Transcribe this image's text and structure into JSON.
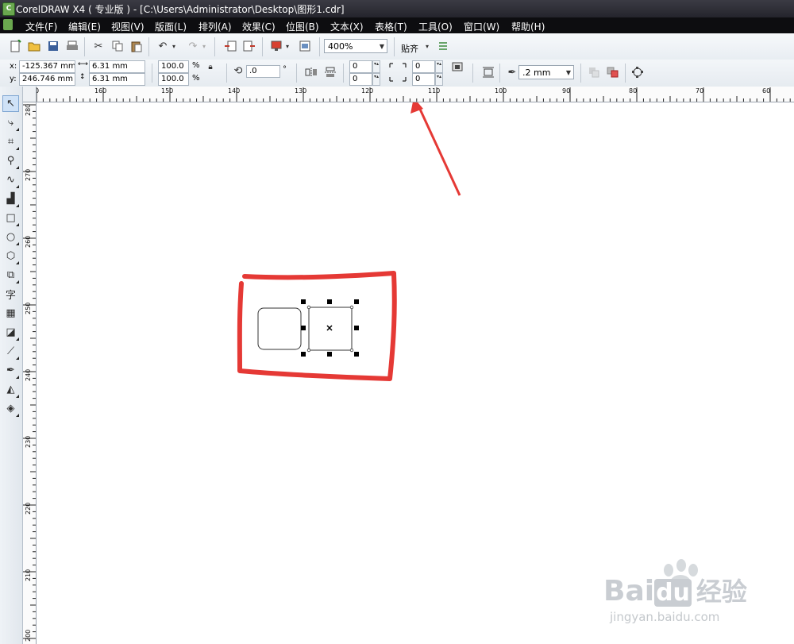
{
  "window": {
    "title": "CorelDRAW X4 ( 专业版 ) - [C:\\Users\\Administrator\\Desktop\\图形1.cdr]"
  },
  "menu": [
    "文件(F)",
    "编辑(E)",
    "视图(V)",
    "版面(L)",
    "排列(A)",
    "效果(C)",
    "位图(B)",
    "文本(X)",
    "表格(T)",
    "工具(O)",
    "窗口(W)",
    "帮助(H)"
  ],
  "standard_toolbar": {
    "zoom": "400%",
    "snap_label": "贴齐"
  },
  "property_bar": {
    "x_label": "x:",
    "x_value": "-125.367 mm",
    "y_label": "y:",
    "y_value": "246.746 mm",
    "width_value": "6.31 mm",
    "height_value": "6.31 mm",
    "scale_x": "100.0",
    "scale_y": "100.0",
    "percent": "%",
    "rotation": ".0",
    "degree": "°",
    "corner_tl": "0",
    "corner_bl": "0",
    "corner_tr": "0",
    "corner_br": "0",
    "outline_width": ".2 mm"
  },
  "ruler": {
    "top_ticks": [
      "0",
      "160",
      "150",
      "140",
      "130",
      "120",
      "110",
      "100",
      "90",
      "80",
      "70",
      "60"
    ],
    "left_ticks": [
      "280",
      "270",
      "260",
      "250",
      "240",
      "230",
      "220",
      "210",
      "200"
    ]
  },
  "watermark": {
    "brand": "Bai",
    "brand2": "du",
    "cn": "经验",
    "url": "jingyan.baidu.com"
  },
  "colors": {
    "annotation_red": "#e53935",
    "titlebar": "#2b2b33",
    "menubar": "#0d0d10"
  }
}
